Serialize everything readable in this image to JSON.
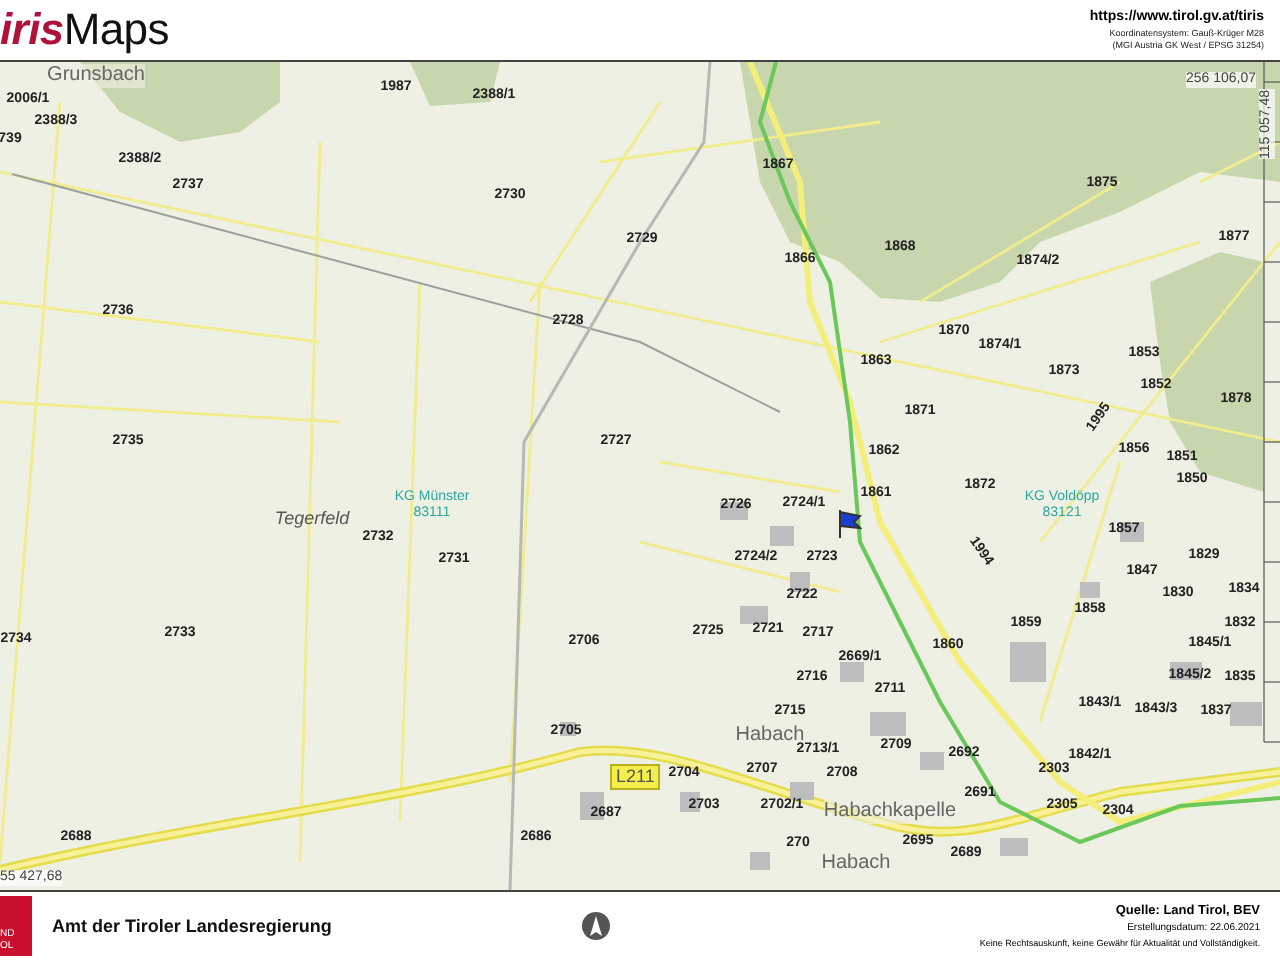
{
  "header": {
    "logo": {
      "prefix": "iris",
      "suffix": "Maps"
    },
    "url": "https://www.tirol.gv.at/tiris",
    "crs_lines": [
      "Koordinatensystem: Gauß-Krüger M28",
      "(MGI Austria GK West / EPSG 31254)"
    ]
  },
  "map": {
    "coordinates": [
      "256 106,07",
      "115 057,48",
      "55 427,68"
    ],
    "places": [
      {
        "text": "Grunsbach",
        "kind": "hamlet"
      },
      {
        "text": "Tegerfeld",
        "kind": "field"
      },
      {
        "text": "Habach",
        "kind": "hamlet"
      },
      {
        "text": "Habachkapelle",
        "kind": "hamlet"
      },
      {
        "text": "Habach",
        "kind": "hamlet"
      }
    ],
    "cadastral_districts": [
      {
        "name": "KG Münster",
        "number": "83111"
      },
      {
        "name": "KG Voldöpp",
        "number": "83121"
      }
    ],
    "road_label": "L211",
    "parcels": [
      "2006/1",
      "1987",
      "2388/1",
      "2388/3",
      "739",
      "2388/2",
      "2737",
      "2730",
      "2729",
      "2728",
      "2736",
      "2735",
      "2727",
      "2732",
      "2731",
      "2734",
      "2733",
      "2706",
      "2705",
      "2688",
      "2686",
      "2687",
      "1867",
      "1866",
      "1868",
      "1875",
      "1874/2",
      "1877",
      "1870",
      "1874/1",
      "1863",
      "1873",
      "1853",
      "1852",
      "1878",
      "1871",
      "1862",
      "1856",
      "1851",
      "1995",
      "1861",
      "1872",
      "1850",
      "2726",
      "2724/1",
      "1857",
      "2724/2",
      "2723",
      "1994",
      "1829",
      "1847",
      "1830",
      "1834",
      "2722",
      "1858",
      "1859",
      "1832",
      "2725",
      "2721",
      "2717",
      "1860",
      "1845/1",
      "2669/1",
      "2716",
      "2711",
      "1845/2",
      "1835",
      "2715",
      "1843/1",
      "1843/3",
      "1837",
      "2713/1",
      "2709",
      "2692",
      "1842/1",
      "2704",
      "2707",
      "2708",
      "2303",
      "2691",
      "2703",
      "2702/1",
      "2305",
      "2304",
      "2695",
      "2689",
      "270"
    ]
  },
  "footer": {
    "logo_text": [
      "ND",
      "OL"
    ],
    "authority": "Amt der Tiroler Landesregierung",
    "source": "Quelle: Land Tirol, BEV",
    "date": "Erstellungsdatum: 22.06.2021",
    "disclaimer": "Keine Rechtsauskunft, keine Gewähr für Aktualität und Vollständigkeit."
  }
}
